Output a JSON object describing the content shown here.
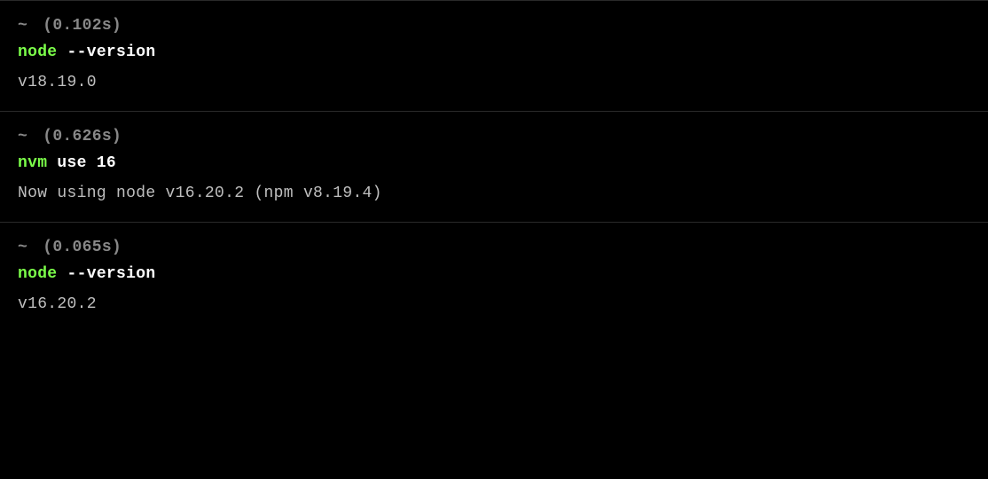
{
  "blocks": [
    {
      "prompt_prefix": "~",
      "timing": "(0.102s)",
      "command_name": "node",
      "command_args": " --version",
      "output": "v18.19.0"
    },
    {
      "prompt_prefix": "~",
      "timing": "(0.626s)",
      "command_name": "nvm",
      "command_args": " use 16",
      "output": "Now using node v16.20.2 (npm v8.19.4)"
    },
    {
      "prompt_prefix": "~",
      "timing": "(0.065s)",
      "command_name": "node",
      "command_args": " --version",
      "output": "v16.20.2"
    }
  ]
}
